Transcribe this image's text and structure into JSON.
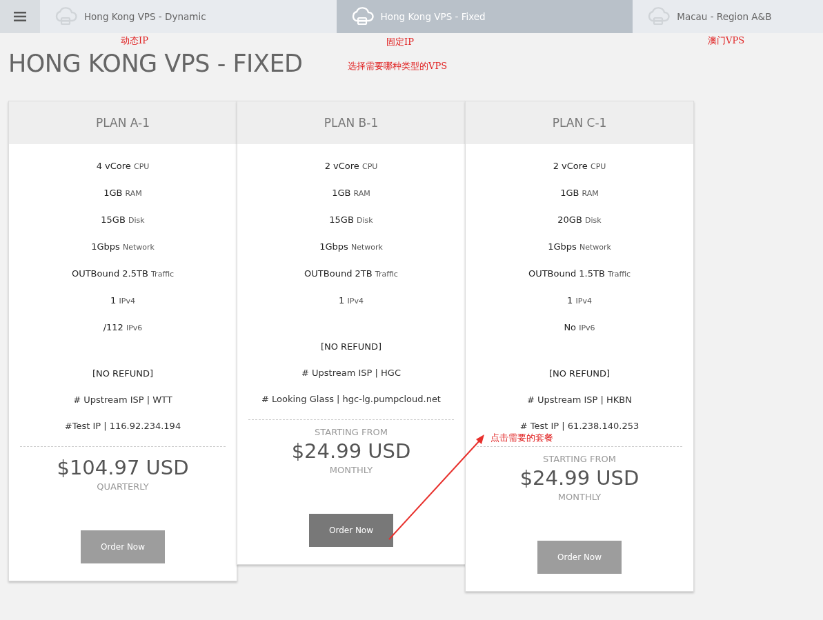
{
  "tabs": [
    {
      "label": "Hong Kong VPS - Dynamic",
      "selected": false
    },
    {
      "label": "Hong Kong VPS - Fixed",
      "selected": true
    },
    {
      "label": "Macau - Region A&B",
      "selected": false
    }
  ],
  "title": "HONG KONG VPS - FIXED",
  "plans": [
    {
      "name": "PLAN A-1",
      "specs": [
        {
          "value": "4 vCore",
          "unit": "CPU"
        },
        {
          "value": "1GB",
          "unit": "RAM"
        },
        {
          "value": "15GB",
          "unit": "Disk"
        },
        {
          "value": "1Gbps",
          "unit": "Network"
        },
        {
          "value": "OUTBound 2.5TB",
          "unit": "Traffic"
        },
        {
          "value": "1",
          "unit": "IPv4"
        },
        {
          "value": "/112",
          "unit": "IPv6"
        }
      ],
      "notes": [
        "[NO REFUND]",
        "# Upstream ISP | WTT",
        "#Test IP | 116.92.234.194"
      ],
      "price": "$104.97 USD",
      "period": "QUARTERLY",
      "button": {
        "label": "Order Now",
        "hovered": false
      }
    },
    {
      "name": "PLAN B-1",
      "specs": [
        {
          "value": "2 vCore",
          "unit": "CPU"
        },
        {
          "value": "1GB",
          "unit": "RAM"
        },
        {
          "value": "15GB",
          "unit": "Disk"
        },
        {
          "value": "1Gbps",
          "unit": "Network"
        },
        {
          "value": "OUTBound 2TB",
          "unit": "Traffic"
        },
        {
          "value": "1",
          "unit": "IPv4"
        }
      ],
      "notes": [
        "[NO REFUND]",
        "# Upstream ISP | HGC",
        "# Looking Glass | hgc-lg.pumpcloud.net"
      ],
      "starting": "STARTING FROM",
      "price": "$24.99 USD",
      "period": "MONTHLY",
      "button": {
        "label": "Order Now",
        "hovered": true
      }
    },
    {
      "name": "PLAN C-1",
      "specs": [
        {
          "value": "2 vCore",
          "unit": "CPU"
        },
        {
          "value": "1GB",
          "unit": "RAM"
        },
        {
          "value": "20GB",
          "unit": "Disk"
        },
        {
          "value": "1Gbps",
          "unit": "Network"
        },
        {
          "value": "OUTBound 1.5TB",
          "unit": "Traffic"
        },
        {
          "value": "1",
          "unit": "IPv4"
        },
        {
          "value": "No",
          "unit": "IPv6"
        }
      ],
      "notes": [
        "[NO REFUND]",
        "# Upstream ISP | HKBN",
        "# Test IP | 61.238.140.253"
      ],
      "starting": "STARTING FROM",
      "price": "$24.99 USD",
      "period": "MONTHLY",
      "button": {
        "label": "Order Now",
        "hovered": false
      }
    }
  ],
  "annotations": [
    "动态IP",
    "固定IP",
    "澳门VPS",
    "选择需要哪种类型的VPS",
    "点击需要的套餐"
  ]
}
